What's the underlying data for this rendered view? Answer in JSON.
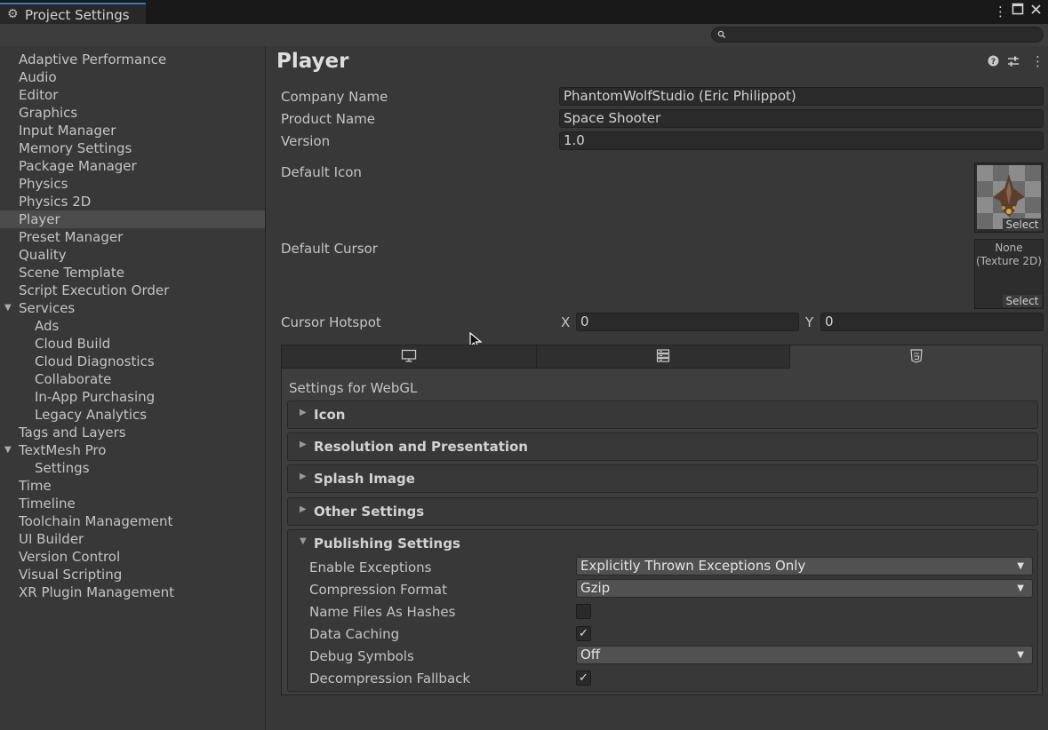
{
  "window": {
    "title": "Project Settings",
    "menu_icon": "kebab-menu-icon",
    "maximize_icon": "maximize-icon",
    "close_icon": "close-icon"
  },
  "search": {
    "placeholder": ""
  },
  "sidebar": {
    "items": [
      {
        "label": "Adaptive Performance"
      },
      {
        "label": "Audio"
      },
      {
        "label": "Editor"
      },
      {
        "label": "Graphics"
      },
      {
        "label": "Input Manager"
      },
      {
        "label": "Memory Settings"
      },
      {
        "label": "Package Manager"
      },
      {
        "label": "Physics"
      },
      {
        "label": "Physics 2D"
      },
      {
        "label": "Player"
      },
      {
        "label": "Preset Manager"
      },
      {
        "label": "Quality"
      },
      {
        "label": "Scene Template"
      },
      {
        "label": "Script Execution Order"
      },
      {
        "label": "Services"
      },
      {
        "label": "Ads"
      },
      {
        "label": "Cloud Build"
      },
      {
        "label": "Cloud Diagnostics"
      },
      {
        "label": "Collaborate"
      },
      {
        "label": "In-App Purchasing"
      },
      {
        "label": "Legacy Analytics"
      },
      {
        "label": "Tags and Layers"
      },
      {
        "label": "TextMesh Pro"
      },
      {
        "label": "Settings"
      },
      {
        "label": "Time"
      },
      {
        "label": "Timeline"
      },
      {
        "label": "Toolchain Management"
      },
      {
        "label": "UI Builder"
      },
      {
        "label": "Version Control"
      },
      {
        "label": "Visual Scripting"
      },
      {
        "label": "XR Plugin Management"
      }
    ],
    "selected": "Player"
  },
  "player": {
    "title": "Player",
    "company_name_label": "Company Name",
    "company_name_value": "PhantomWolfStudio (Eric Philippot)",
    "product_name_label": "Product Name",
    "product_name_value": "Space Shooter",
    "version_label": "Version",
    "version_value": "1.0",
    "default_icon_label": "Default Icon",
    "default_cursor_label": "Default Cursor",
    "cursor_none_line1": "None",
    "cursor_none_line2": "(Texture 2D)",
    "select_label": "Select",
    "cursor_hotspot_label": "Cursor Hotspot",
    "hotspot_x_label": "X",
    "hotspot_x_value": "0",
    "hotspot_y_label": "Y",
    "hotspot_y_value": "0"
  },
  "platform_tabs": [
    {
      "icon": "monitor-icon"
    },
    {
      "icon": "server-icon"
    },
    {
      "icon": "html5-icon",
      "active": true
    }
  ],
  "settings_for": "Settings for WebGL",
  "foldouts": [
    {
      "label": "Icon",
      "expanded": false
    },
    {
      "label": "Resolution and Presentation",
      "expanded": false
    },
    {
      "label": "Splash Image",
      "expanded": false
    },
    {
      "label": "Other Settings",
      "expanded": false
    },
    {
      "label": "Publishing Settings",
      "expanded": true
    }
  ],
  "publishing": {
    "enable_exceptions_label": "Enable Exceptions",
    "enable_exceptions_value": "Explicitly Thrown Exceptions Only",
    "compression_format_label": "Compression Format",
    "compression_format_value": "Gzip",
    "name_files_as_hashes_label": "Name Files As Hashes",
    "name_files_as_hashes_checked": false,
    "data_caching_label": "Data Caching",
    "data_caching_checked": true,
    "debug_symbols_label": "Debug Symbols",
    "debug_symbols_value": "Off",
    "decompression_fallback_label": "Decompression Fallback",
    "decompression_fallback_checked": true
  },
  "colors": {
    "accent_tab": "#3a79bb",
    "background": "#383838",
    "selected_item": "#4c4c4c"
  }
}
